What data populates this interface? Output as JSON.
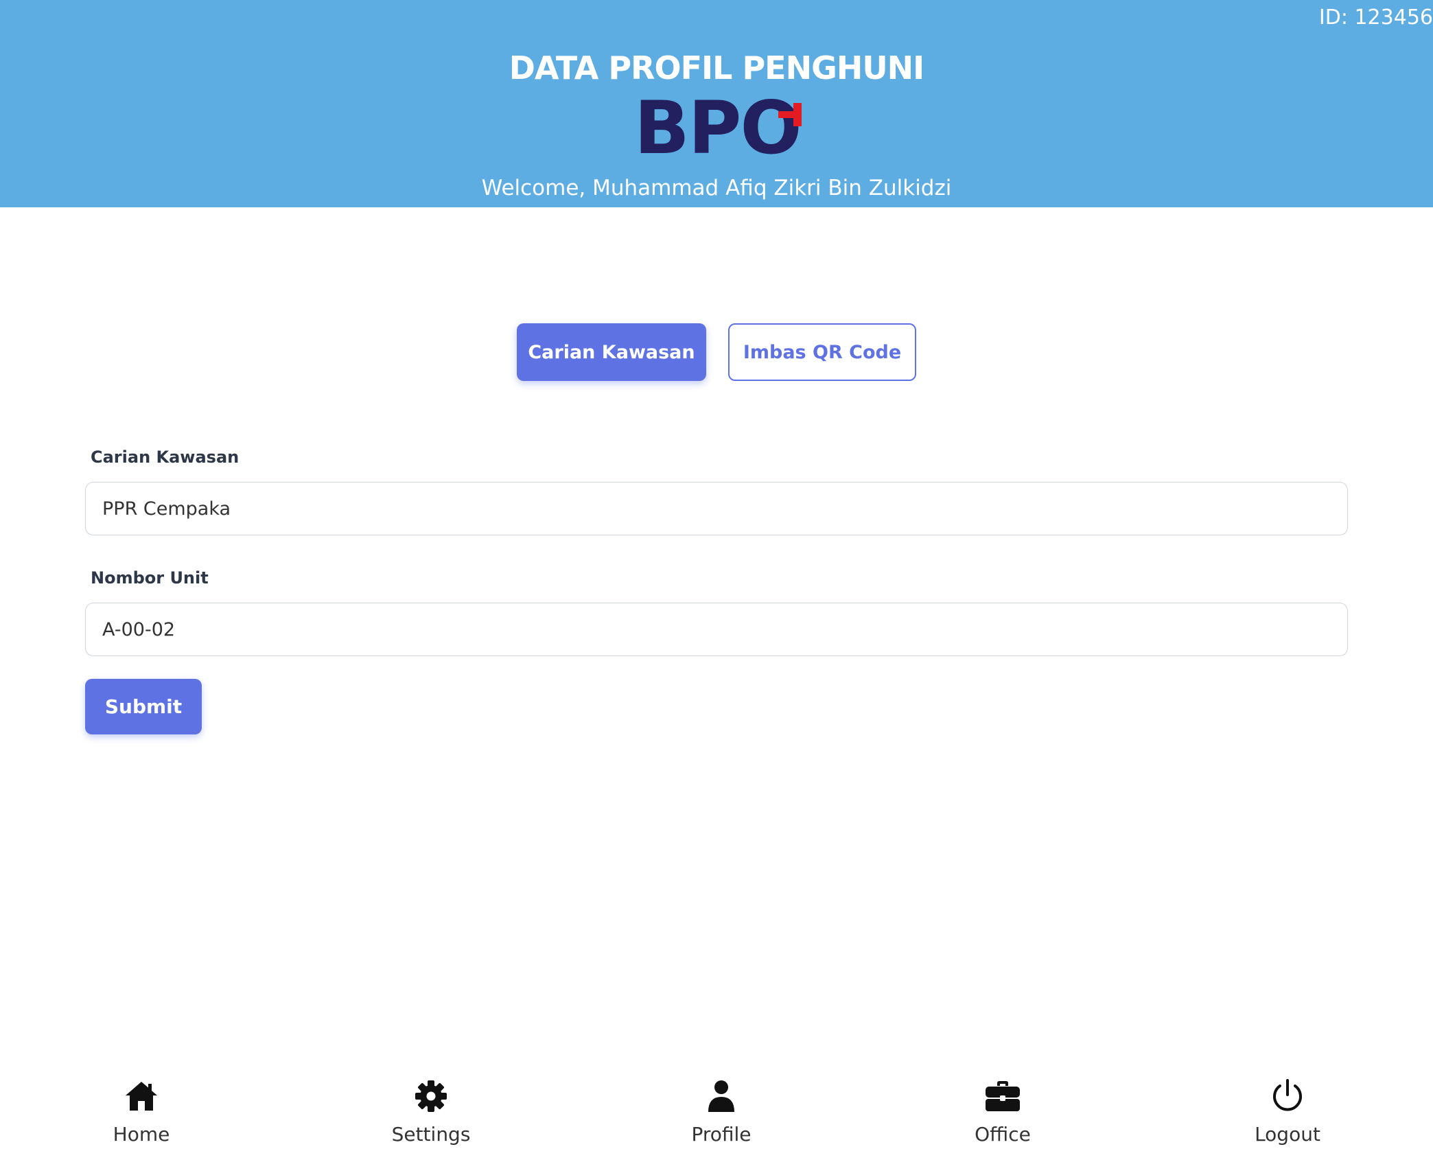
{
  "header": {
    "user_id": "ID: 123456",
    "title": "DATA PROFIL PENGHUNI",
    "logo": {
      "text": "BPO",
      "color": "#232060",
      "accent": "#e31b23"
    },
    "welcome": "Welcome, Muhammad Afiq Zikri Bin Zulkidzi",
    "background": "#5dade2"
  },
  "tabs": [
    {
      "label": "Carian Kawasan",
      "active": true
    },
    {
      "label": "Imbas QR Code",
      "active": false
    }
  ],
  "form": {
    "area_label": "Carian Kawasan",
    "area_value": "PPR Cempaka",
    "unit_label": "Nombor Unit",
    "unit_value": "A-00-02",
    "submit_label": "Submit",
    "accent": "#5f72e3"
  },
  "nav": {
    "items": [
      {
        "label": "Home",
        "icon": "home-icon"
      },
      {
        "label": "Settings",
        "icon": "gear-icon"
      },
      {
        "label": "Profile",
        "icon": "user-icon"
      },
      {
        "label": "Office",
        "icon": "briefcase-icon"
      },
      {
        "label": "Logout",
        "icon": "power-icon"
      }
    ]
  }
}
